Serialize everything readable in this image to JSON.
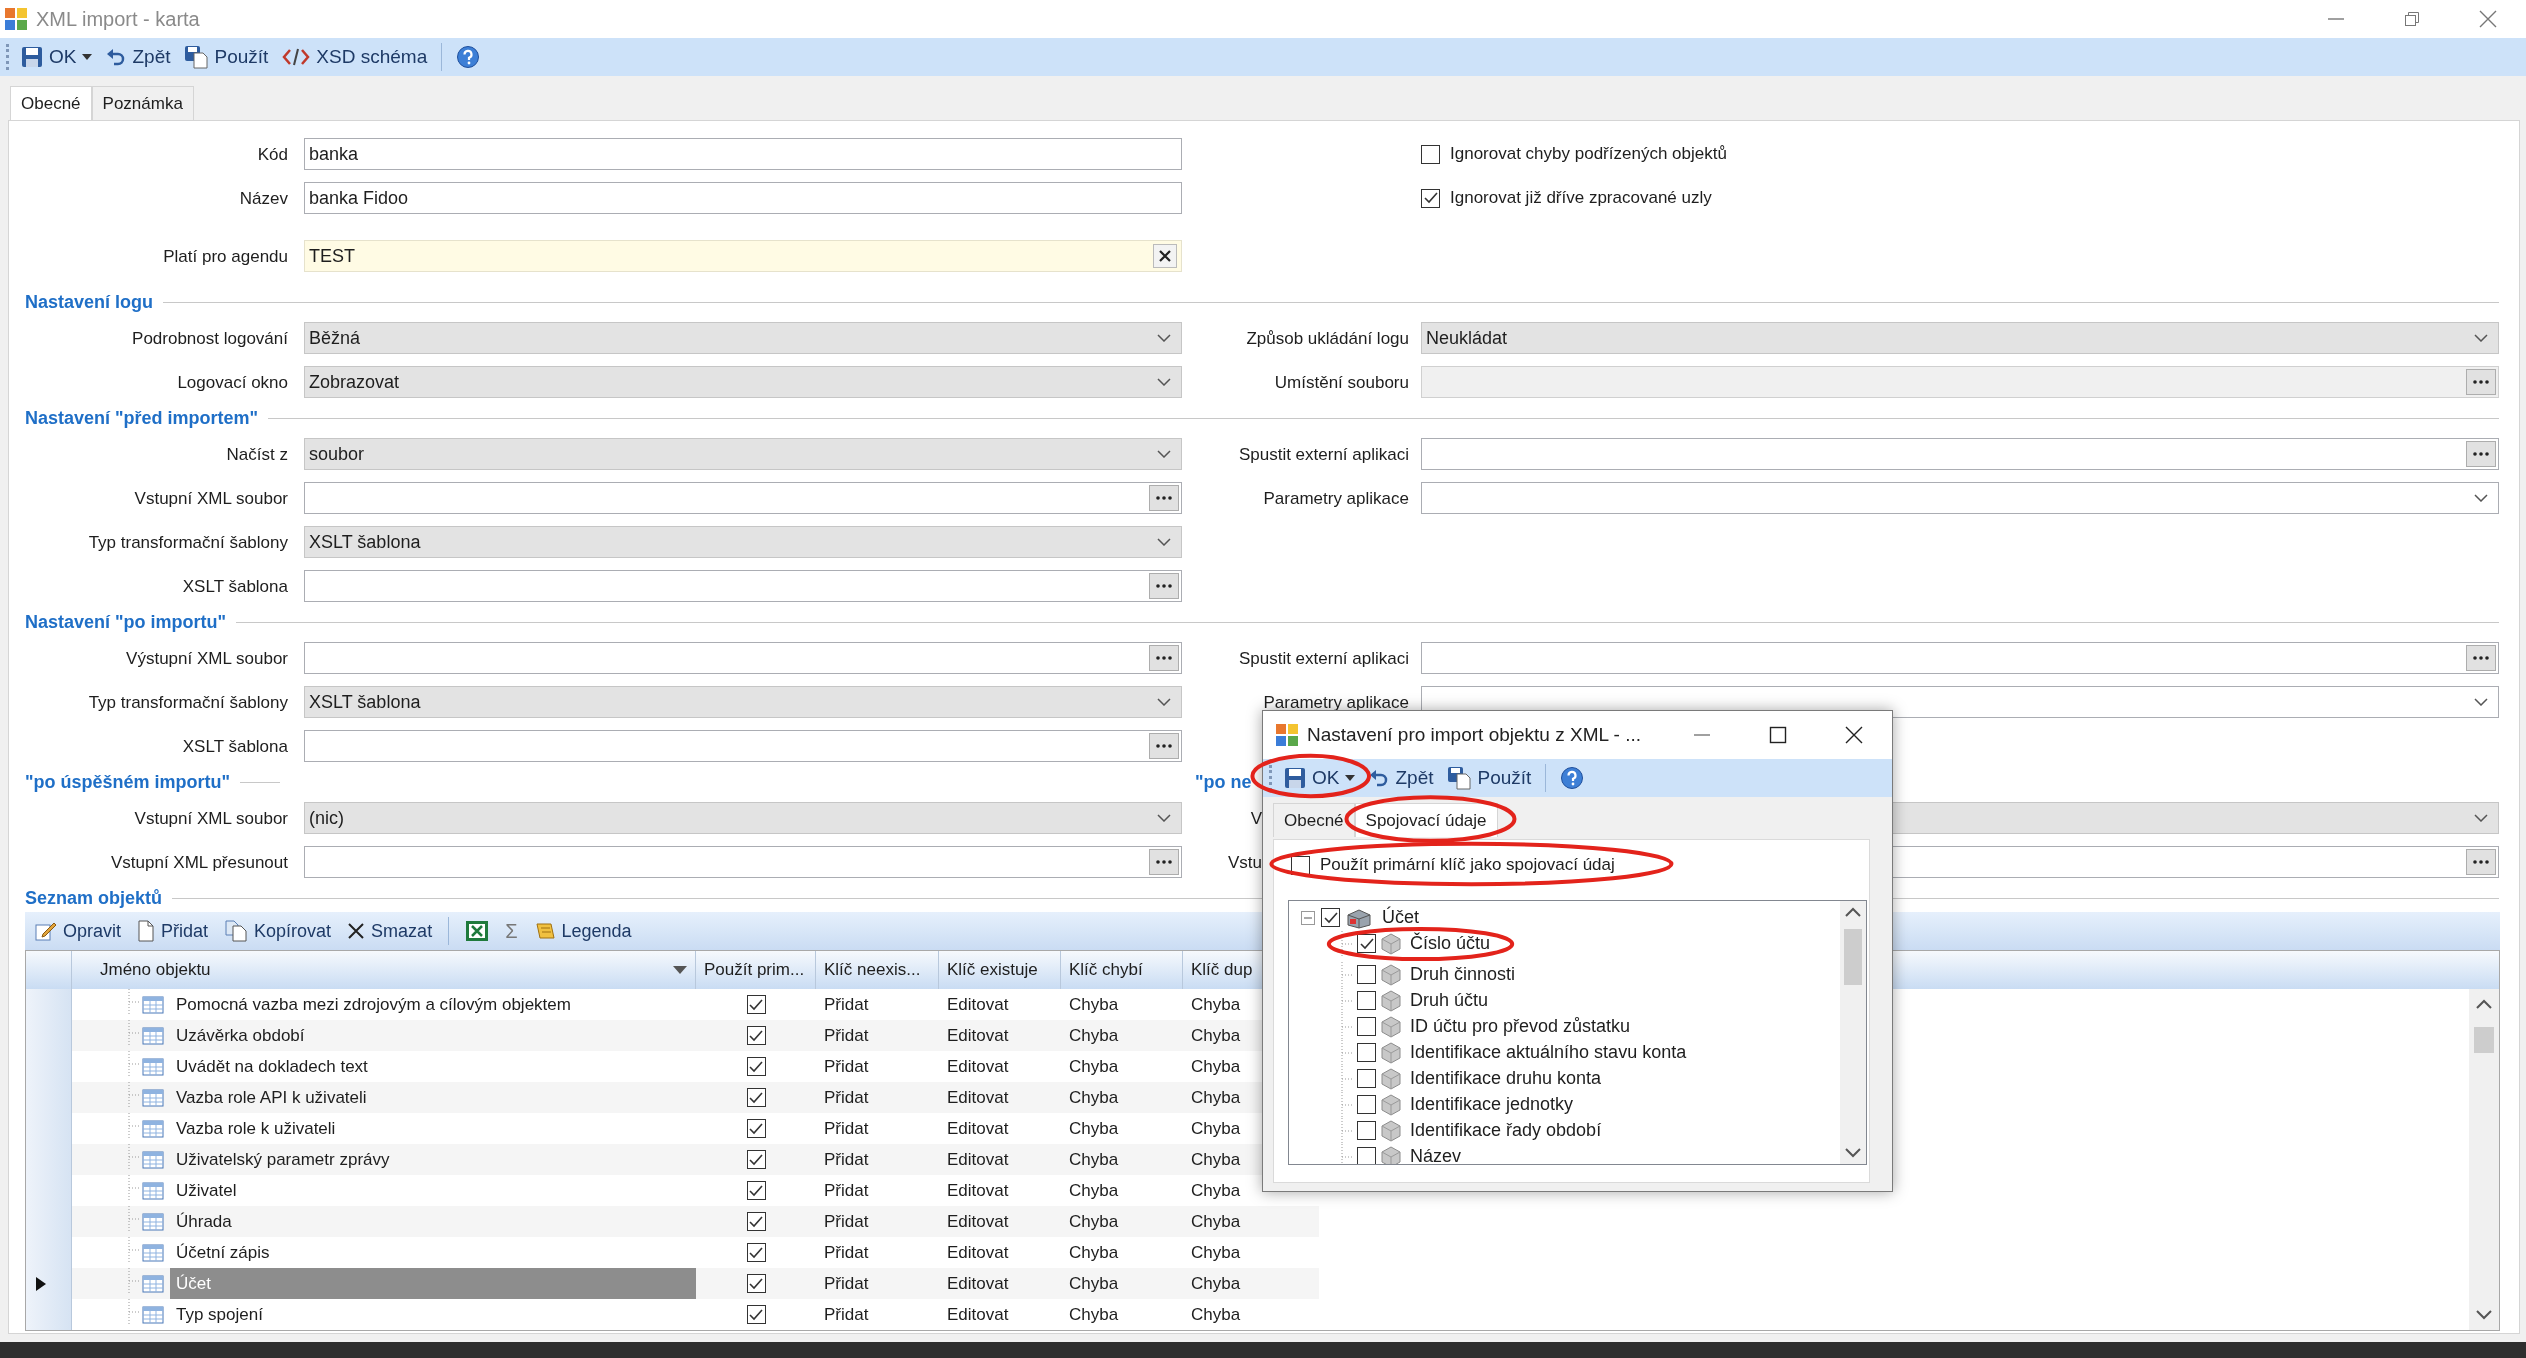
{
  "window": {
    "title": "XML import - karta"
  },
  "toolbar": [
    {
      "label": "OK",
      "kind": "split"
    },
    {
      "label": "Zpět",
      "kind": "button"
    },
    {
      "label": "Použít",
      "kind": "button"
    },
    {
      "label": "XSD schéma",
      "kind": "button"
    },
    {
      "kind": "help"
    }
  ],
  "tabs": [
    {
      "label": "Obecné",
      "selected": true
    },
    {
      "label": "Poznámka",
      "selected": false
    }
  ],
  "general_rows": [
    {
      "left": {
        "label": "Kód",
        "kind": "text",
        "value": "banka"
      },
      "right": {
        "kind": "checkbox",
        "label": "Ignorovat chyby podřízených objektů",
        "checked": false
      }
    },
    {
      "left": {
        "label": "Název",
        "kind": "text",
        "value": "banka Fidoo"
      },
      "right": {
        "kind": "checkbox",
        "label": "Ignorovat již dříve zpracované uzly",
        "checked": true
      }
    },
    {
      "left": {
        "label": "Platí pro agendu",
        "kind": "clearable",
        "value": "TEST"
      }
    }
  ],
  "sections": [
    {
      "heading": "Nastavení logu",
      "rows": [
        {
          "left": {
            "label": "Podrobnost logování",
            "kind": "combo",
            "value": "Běžná"
          },
          "right": {
            "label": "Způsob ukládání logu",
            "kind": "combo",
            "value": "Neukládat"
          }
        },
        {
          "left": {
            "label": "Logovací okno",
            "kind": "combo",
            "value": "Zobrazovat"
          },
          "right": {
            "label": "Umístění souboru",
            "kind": "browse",
            "disabled": true
          }
        }
      ]
    },
    {
      "heading": "Nastavení \"před importem\"",
      "rows": [
        {
          "left": {
            "label": "Načíst z",
            "kind": "combo",
            "value": "soubor"
          },
          "right": {
            "label": "Spustit externí aplikaci",
            "kind": "browse"
          }
        },
        {
          "left": {
            "label": "Vstupní XML soubor",
            "kind": "browse"
          },
          "right": {
            "label": "Parametry aplikace",
            "kind": "combo_edit"
          }
        },
        {
          "left": {
            "label": "Typ transformační šablony",
            "kind": "combo",
            "value": "XSLT šablona"
          }
        },
        {
          "left": {
            "label": "XSLT šablona",
            "kind": "browse"
          }
        }
      ]
    },
    {
      "heading": "Nastavení \"po importu\"",
      "rows": [
        {
          "left": {
            "label": "Výstupní XML soubor",
            "kind": "browse"
          },
          "right": {
            "label": "Spustit externí aplikaci",
            "kind": "browse"
          }
        },
        {
          "left": {
            "label": "Typ transformační šablony",
            "kind": "combo",
            "value": "XSLT šablona"
          },
          "right": {
            "label": "Parametry aplikace",
            "kind": "combo_edit"
          }
        },
        {
          "left": {
            "label": "XSLT šablona",
            "kind": "browse"
          }
        }
      ]
    },
    {
      "heading": "\"po úspěšném importu\"",
      "heading_right": "\"po ne",
      "rows": [
        {
          "left": {
            "label": "Vstupní XML soubor",
            "kind": "combo",
            "value": "(nic)"
          },
          "right": {
            "label": "V",
            "label_cut": true,
            "kind": "combo"
          }
        },
        {
          "left": {
            "label": "Vstupní XML přesunout",
            "kind": "browse"
          },
          "right": {
            "label": "Vstu",
            "label_cut": true,
            "kind": "browse"
          }
        }
      ]
    }
  ],
  "objects": {
    "heading": "Seznam objektů",
    "toolbar": [
      {
        "label": "Opravit",
        "kind": "button"
      },
      {
        "label": "Přidat",
        "kind": "button"
      },
      {
        "label": "Kopírovat",
        "kind": "button"
      },
      {
        "label": "Smazat",
        "kind": "button"
      },
      {
        "kind": "icon"
      },
      {
        "label": "Σ",
        "kind": "symbol"
      },
      {
        "label": "Legenda",
        "kind": "button"
      }
    ],
    "columns": [
      "Jméno objektu",
      "Použít prim...",
      "Klíč neexis...",
      "Klíč existuje",
      "Klíč chybí",
      "Klíč dup"
    ],
    "rows": [
      {
        "name": "Pomocná vazba mezi zdrojovým a cílovým objektem",
        "use_primary": true,
        "not_exists": "Přidat",
        "exists": "Editovat",
        "missing": "Chyba",
        "duplicate": "Chyba",
        "selected": false
      },
      {
        "name": "Uzávěrka období",
        "use_primary": true,
        "not_exists": "Přidat",
        "exists": "Editovat",
        "missing": "Chyba",
        "duplicate": "Chyba",
        "selected": false
      },
      {
        "name": "Uvádět na dokladech text",
        "use_primary": true,
        "not_exists": "Přidat",
        "exists": "Editovat",
        "missing": "Chyba",
        "duplicate": "Chyba",
        "selected": false
      },
      {
        "name": "Vazba role API k uživateli",
        "use_primary": true,
        "not_exists": "Přidat",
        "exists": "Editovat",
        "missing": "Chyba",
        "duplicate": "Chyba",
        "selected": false
      },
      {
        "name": "Vazba role k uživateli",
        "use_primary": true,
        "not_exists": "Přidat",
        "exists": "Editovat",
        "missing": "Chyba",
        "duplicate": "Chyba",
        "selected": false
      },
      {
        "name": "Uživatelský parametr zprávy",
        "use_primary": true,
        "not_exists": "Přidat",
        "exists": "Editovat",
        "missing": "Chyba",
        "duplicate": "Chyba",
        "selected": false
      },
      {
        "name": "Uživatel",
        "use_primary": true,
        "not_exists": "Přidat",
        "exists": "Editovat",
        "missing": "Chyba",
        "duplicate": "Chyba",
        "selected": false
      },
      {
        "name": "Úhrada",
        "use_primary": true,
        "not_exists": "Přidat",
        "exists": "Editovat",
        "missing": "Chyba",
        "duplicate": "Chyba",
        "selected": false
      },
      {
        "name": "Účetní zápis",
        "use_primary": true,
        "not_exists": "Přidat",
        "exists": "Editovat",
        "missing": "Chyba",
        "duplicate": "Chyba",
        "selected": false
      },
      {
        "name": "Účet",
        "use_primary": true,
        "not_exists": "Přidat",
        "exists": "Editovat",
        "missing": "Chyba",
        "duplicate": "Chyba",
        "selected": true
      },
      {
        "name": "Typ spojení",
        "use_primary": true,
        "not_exists": "Přidat",
        "exists": "Editovat",
        "missing": "Chyba",
        "duplicate": "Chyba",
        "selected": false
      }
    ]
  },
  "dialog": {
    "title": "Nastavení pro import objektu z XML - ...",
    "toolbar": [
      {
        "label": "OK",
        "kind": "split",
        "circled": true
      },
      {
        "label": "Zpět",
        "kind": "button",
        "circled": false
      },
      {
        "label": "Použít",
        "kind": "button",
        "circled": false
      },
      {
        "kind": "help",
        "circled": false
      }
    ],
    "tabs": [
      {
        "label": "Obecné",
        "selected": false,
        "circled": false
      },
      {
        "label": "Spojovací údaje",
        "selected": true,
        "circled": true
      }
    ],
    "key_checkbox": {
      "label": "Použít primární klíč jako spojovací údaj",
      "checked": false,
      "circled": true
    },
    "tree": {
      "label": "Účet",
      "checked": true,
      "expanded": true,
      "circled": false,
      "children": [
        {
          "label": "Číslo účtu",
          "checked": true,
          "circled": true
        },
        {
          "label": "Druh činnosti",
          "checked": false,
          "circled": false
        },
        {
          "label": "Druh účtu",
          "checked": false,
          "circled": false
        },
        {
          "label": "ID účtu pro převod zůstatku",
          "checked": false,
          "circled": false
        },
        {
          "label": "Identifikace aktuálního stavu konta",
          "checked": false,
          "circled": false
        },
        {
          "label": "Identifikace druhu konta",
          "checked": false,
          "circled": false
        },
        {
          "label": "Identifikace jednotky",
          "checked": false,
          "circled": false
        },
        {
          "label": "Identifikace řady období",
          "checked": false,
          "circled": false
        },
        {
          "label": "Název",
          "checked": false,
          "circled": false
        }
      ]
    }
  }
}
